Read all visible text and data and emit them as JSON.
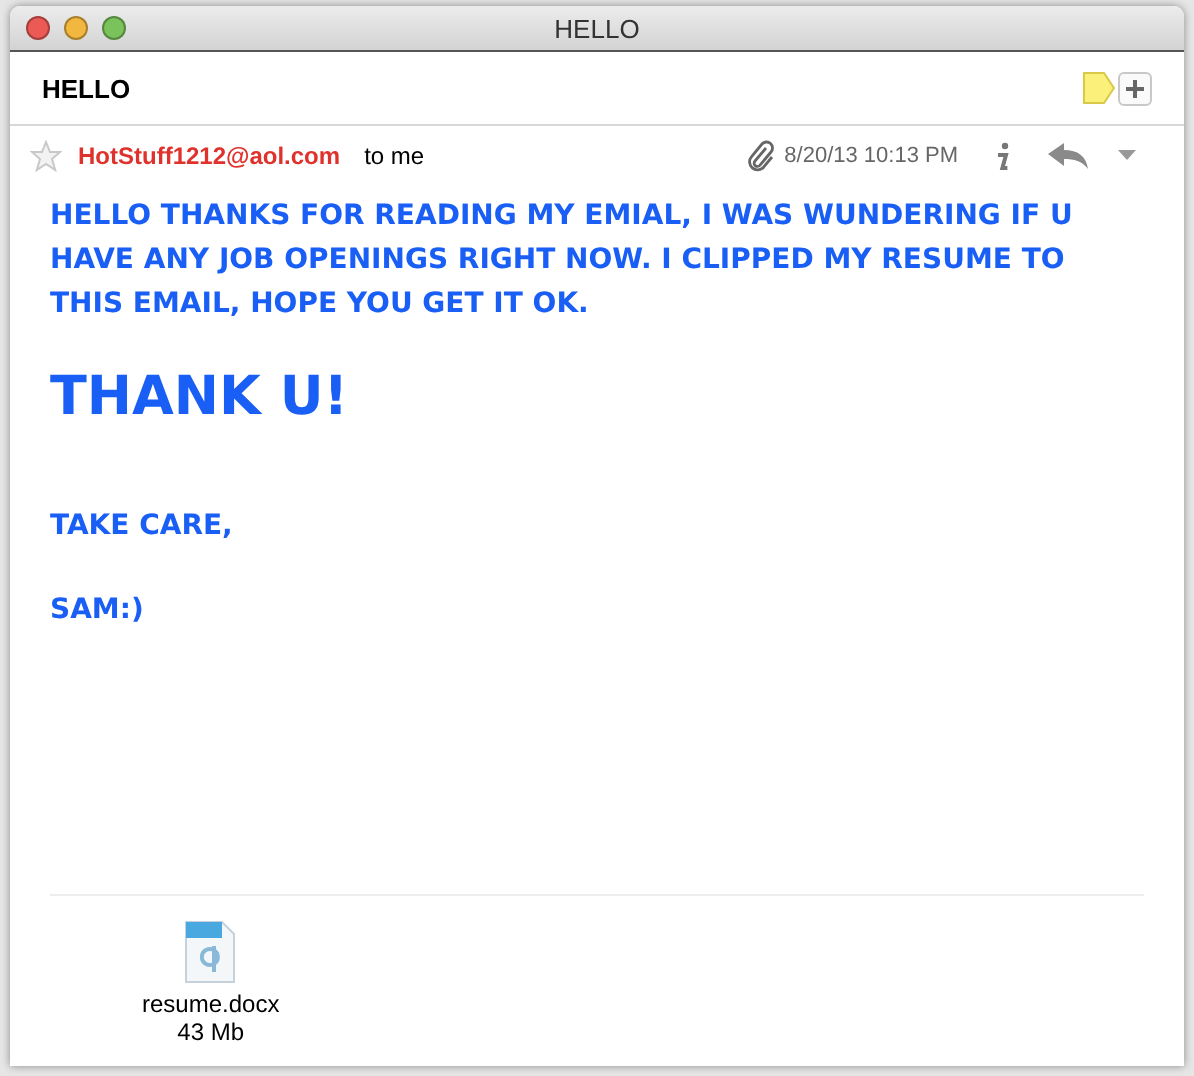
{
  "window": {
    "title": "HELLO"
  },
  "subject": "HELLO",
  "header": {
    "starred": false,
    "sender": "HotStuff1212@aol.com",
    "recipient": "to me",
    "has_attachment": true,
    "date": "8/20/13 10:13 PM"
  },
  "body": [
    {
      "kind": "text",
      "text": "HELLO THANKS FOR READING MY EMIAL, I WAS WUNDERING IF U HAVE ANY JOB OPENINGS RIGHT NOW.  I CLIPPED MY RESUME TO THIS EMAIL, HOPE YOU GET IT OK."
    },
    {
      "kind": "heading",
      "text": "THANK U!"
    },
    {
      "kind": "text",
      "text": "TAKE CARE,"
    },
    {
      "kind": "text",
      "text": "SAM:)"
    }
  ],
  "attachments": [
    {
      "name": "resume.docx",
      "size": "43 Mb"
    }
  ]
}
